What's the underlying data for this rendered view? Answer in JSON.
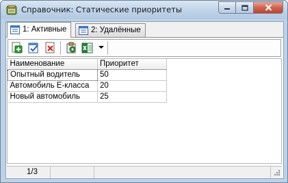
{
  "window": {
    "title": "Справочник: Статические приоритеты",
    "app_icon": "reference-book-icon",
    "controls": [
      "minimize-icon",
      "maximize-icon",
      "close-icon"
    ]
  },
  "tabs": [
    {
      "label": "1: Активные",
      "active": true,
      "icon": "table-icon"
    },
    {
      "label": "2: Удалённые",
      "active": false,
      "icon": "table-icon"
    }
  ],
  "toolbar": {
    "buttons": [
      "add-icon",
      "edit-icon",
      "delete-icon",
      "properties-icon",
      "excel-export-icon",
      "dropdown-arrow-icon"
    ]
  },
  "table": {
    "columns": [
      "Наименование",
      "Приоритет"
    ],
    "rows": [
      {
        "name": "Опытный водитель",
        "priority": "50"
      },
      {
        "name": "Автомобиль E-класса",
        "priority": "20"
      },
      {
        "name": "Новый автомобиль",
        "priority": "25"
      }
    ]
  },
  "status": {
    "record_position": "1/3"
  },
  "colors": {
    "title_bar": "#bfd3e8",
    "close_button": "#c9533c",
    "grid_line": "#c8c8c8"
  }
}
